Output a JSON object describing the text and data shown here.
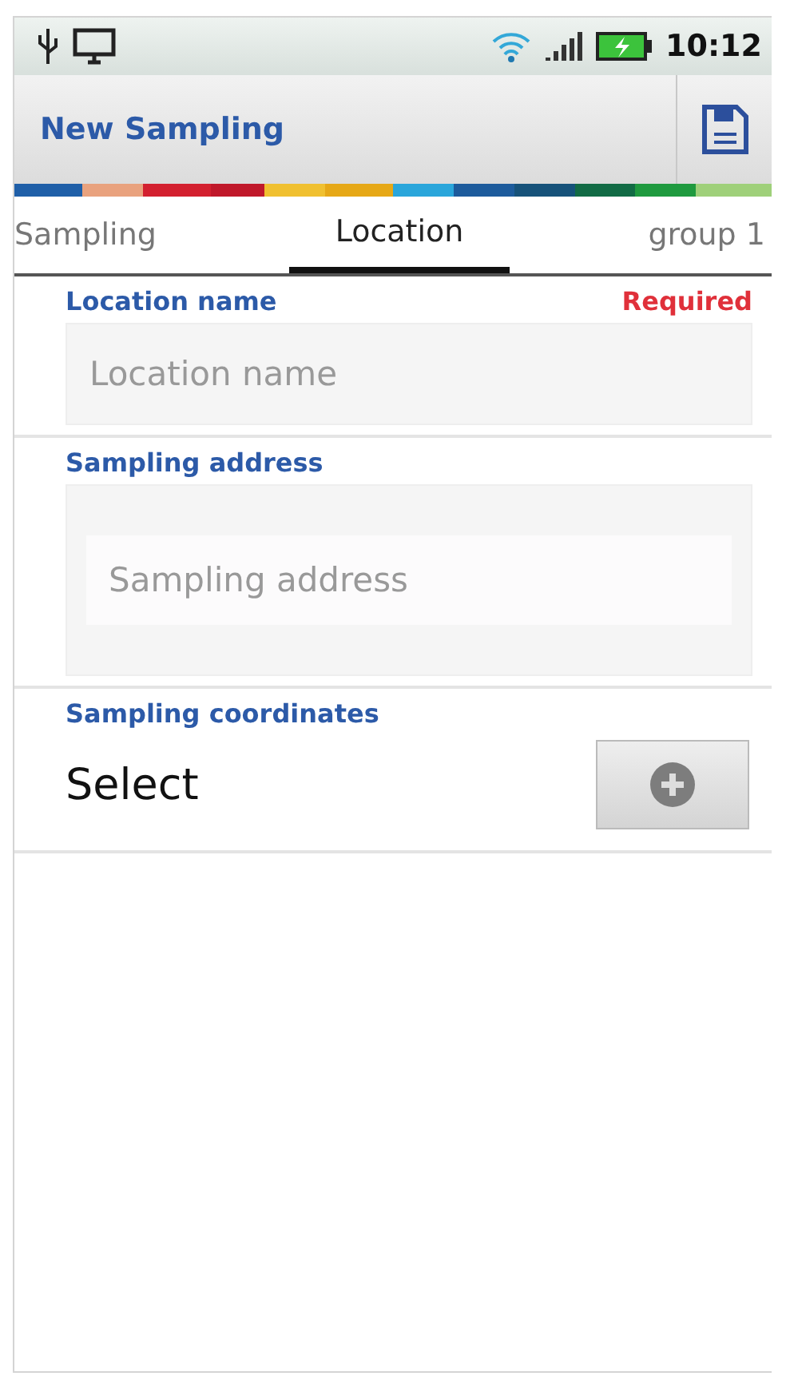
{
  "status_bar": {
    "time": "10:12"
  },
  "action_bar": {
    "title": "New Sampling"
  },
  "tabs": [
    {
      "label": "Sampling",
      "selected": false
    },
    {
      "label": "Location",
      "selected": true
    },
    {
      "label": "group 1",
      "selected": false
    }
  ],
  "fields": [
    {
      "kind": "text",
      "label": "Location name",
      "required_note": "Required",
      "placeholder": "Location name"
    },
    {
      "kind": "textarea",
      "label": "Sampling address",
      "placeholder": "Sampling address"
    },
    {
      "kind": "select",
      "label": "Sampling coordinates",
      "value": "Select"
    }
  ]
}
